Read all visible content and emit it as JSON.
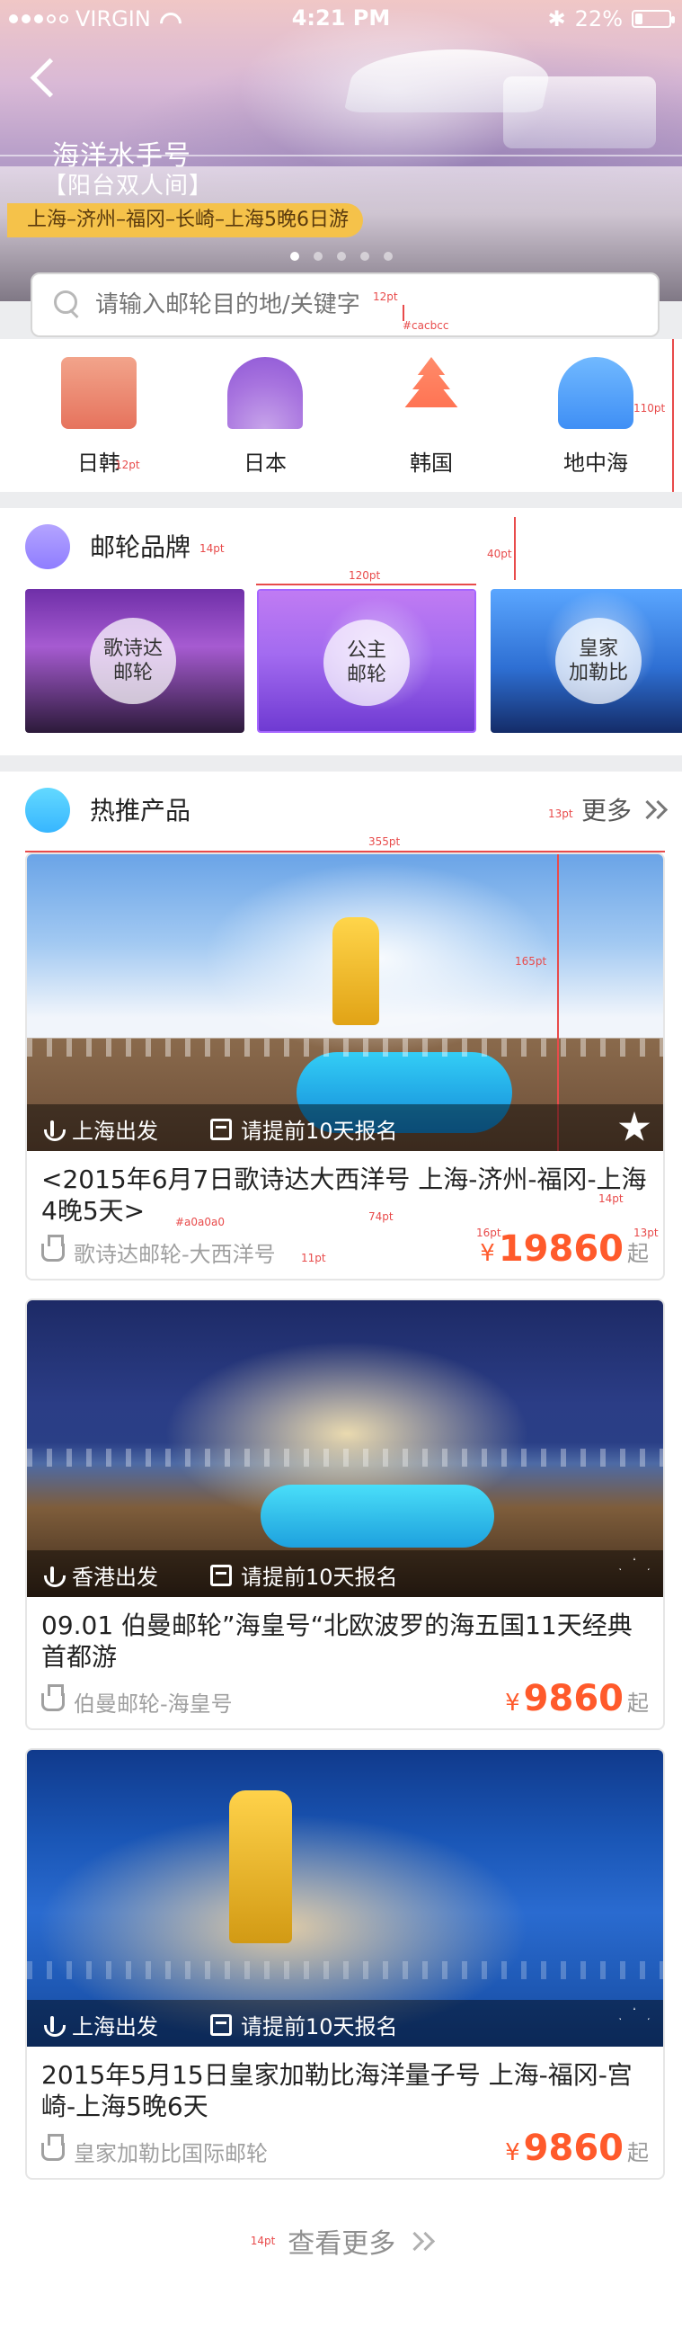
{
  "status": {
    "carrier": "VIRGIN",
    "time": "4:21 PM",
    "battery": "22%",
    "battery_level": 0.22
  },
  "hero": {
    "title": "海洋水手号",
    "tag": "【阳台双人间】",
    "route": "上海–济州–福冈–长崎–上海5晚6日游",
    "dots_total": 5,
    "dots_active_index": 0
  },
  "search": {
    "placeholder": "请输入邮轮目的地/关键字"
  },
  "spec": {
    "search_font": "12pt",
    "search_color": "#cacbcc",
    "cats_height": "110pt",
    "cat_label_font": "12pt",
    "left_margin": "10pt",
    "section_title_font": "14pt",
    "brand_height": "40pt",
    "brand_card_width": "120pt",
    "hot_width": "355pt",
    "hot_img_height": "165pt",
    "hot_more_font": "13pt",
    "card_title_font": "14pt",
    "card_meta_color": "#a0a0a0",
    "card_meta_font": "11pt",
    "card_price_font": "16pt",
    "card_price_suffix_font": "13pt",
    "card_height": "74pt",
    "see_more_font": "14pt"
  },
  "categories": [
    {
      "label": "日韩",
      "icon": "temple-icon"
    },
    {
      "label": "日本",
      "icon": "fan-icon"
    },
    {
      "label": "韩国",
      "icon": "pagoda-icon"
    },
    {
      "label": "地中海",
      "icon": "dome-icon"
    }
  ],
  "brands_section": {
    "title": "邮轮品牌",
    "items": [
      {
        "label": "歌诗达\n邮轮"
      },
      {
        "label": "公主\n邮轮"
      },
      {
        "label": "皇家\n加勒比"
      }
    ]
  },
  "hot_section": {
    "title": "热推产品",
    "more": "更多",
    "products": [
      {
        "depart": "上海出发",
        "deadline": "请提前10天报名",
        "favorited": true,
        "title": "<2015年6月7日歌诗达大西洋号 上海-济州-福冈-上海4晚5天>",
        "brand_line": "歌诗达邮轮-大西洋号",
        "price_currency": "¥",
        "price": "19860",
        "price_suffix": "起"
      },
      {
        "depart": "香港出发",
        "deadline": "请提前10天报名",
        "favorited": false,
        "title": "09.01 伯曼邮轮”海皇号“北欧波罗的海五国11天经典首都游",
        "brand_line": "伯曼邮轮-海皇号",
        "price_currency": "¥",
        "price": "9860",
        "price_suffix": "起"
      },
      {
        "depart": "上海出发",
        "deadline": "请提前10天报名",
        "favorited": false,
        "title": "2015年5月15日皇家加勒比海洋量子号 上海-福冈-宫崎-上海5晚6天",
        "brand_line": "皇家加勒比国际邮轮",
        "price_currency": "¥",
        "price": "9860",
        "price_suffix": "起"
      }
    ],
    "see_more": "查看更多"
  }
}
